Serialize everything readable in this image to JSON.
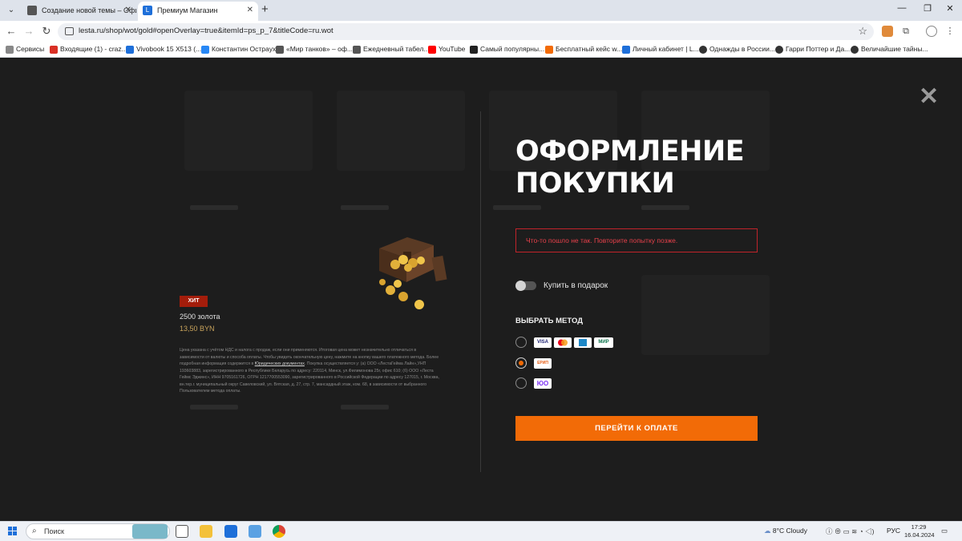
{
  "browser": {
    "tabs": [
      {
        "title": "Создание новой темы – Офиц",
        "active": false
      },
      {
        "title": "Премиум Магазин",
        "active": true
      }
    ],
    "url": "lesta.ru/shop/wot/gold#openOverlay=true&itemId=ps_p_7&titleCode=ru.wot",
    "bookmarks": [
      "Сервисы",
      "Входящие (1) - craz...",
      "Vivobook 15 X513 (...",
      "Константин Острaух",
      "«Мир танков» – оф...",
      "Ежедневный табел...",
      "YouTube",
      "Самый популярны...",
      "Бесплатный кейс w...",
      "Личный кабинет | L...",
      "Однажды в России...",
      "Гарри Поттер и Да...",
      "Величайшие тайны..."
    ]
  },
  "product": {
    "badge": "ХИТ",
    "name": "2500 золота",
    "price": "13,50 BYN",
    "disclaimer_pre": "Цена указана с учётом НДС и налога с продаж, если они применяются. Итоговая цена может незначительно отличаться в зависимости от валюты и способа оплаты. Чтобы увидеть окончательную цену, нажмите на кнопку вашего платежного метода. Более подробная информация содержится в ",
    "disclaimer_link": "Юридических документах",
    "disclaimer_post": ". Покупка осуществляется у: (а) ООО «ЛестаГейма Лайн»,УНП 193603883, зарегистрированного в Республике Беларусь по адресу: 220114, Минск, ул.Филимонова 25г, офис 610; (б) ООО «Леста Геймс Эджинс», ИНН 9705161726, ОГРН 1217700553090, зарегистрированного в Российской Федерации по адресу 127015, г. Москва, вн.тер.г. муниципальный округ Савеловский, ул. Вятская, д. 27, стр. 7, мансардный этаж, ком. 68, в зависимости от выбранного Пользователем метода оплаты."
  },
  "checkout": {
    "heading_line1": "ОФОРМЛЕНИЕ",
    "heading_line2": "ПОКУПКИ",
    "error": "Что-то пошло не так. Повторите попытку позже.",
    "gift_label": "Купить в подарок",
    "gift_enabled": false,
    "method_title": "ВЫБРАТЬ МЕТОД",
    "methods": [
      {
        "logos": [
          "VISA",
          "MC",
          "SBP",
          "МИР"
        ],
        "selected": false
      },
      {
        "logos": [
          "ЕРИП"
        ],
        "selected": true
      },
      {
        "logos": [
          "ЮMoney"
        ],
        "selected": false
      }
    ],
    "pay_button": "ПЕРЕЙТИ К ОПЛАТЕ"
  },
  "taskbar": {
    "search_placeholder": "Поиск",
    "weather": "8°C  Cloudy",
    "language": "РУС",
    "time": "17:29",
    "date": "16.04.2024"
  },
  "colors": {
    "accent": "#f26b07",
    "error": "#c0232a",
    "badge": "#a41d0b",
    "price": "#c9a45c"
  }
}
